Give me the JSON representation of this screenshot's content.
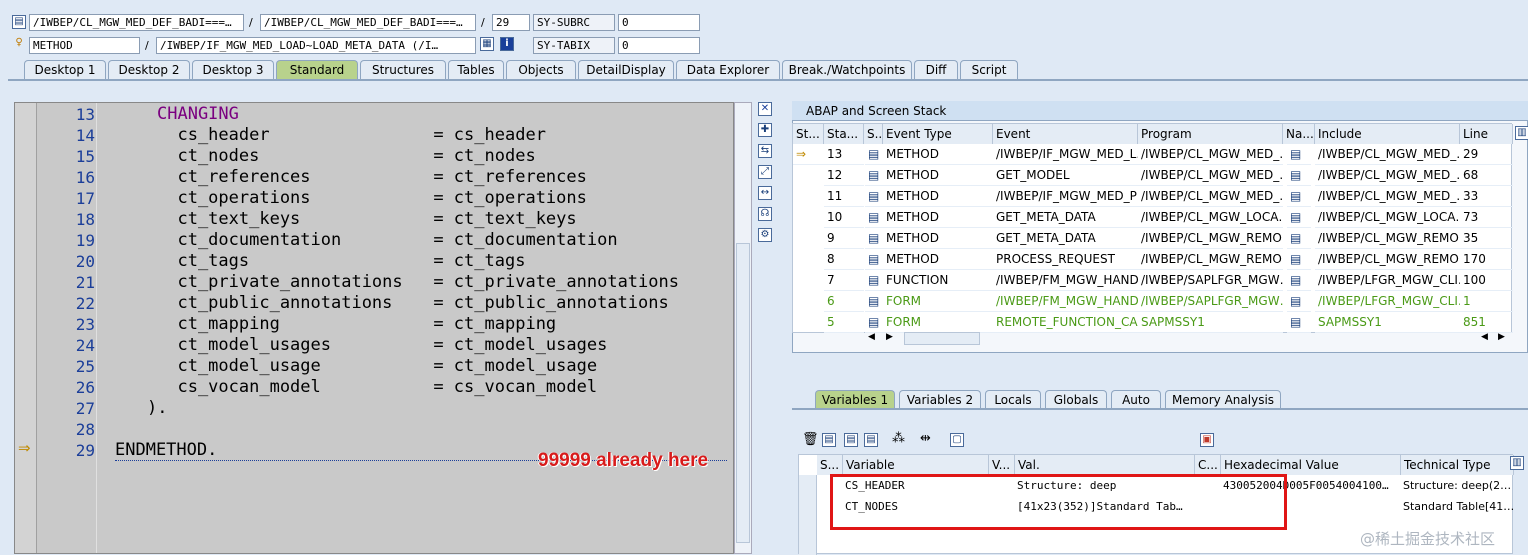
{
  "header": {
    "row1": {
      "field1": "/IWBEP/CL_MGW_MED_DEF_BADI===…",
      "sep": "/",
      "field2": "/IWBEP/CL_MGW_MED_DEF_BADI===…",
      "sep2": "/",
      "line": "29",
      "syslabel": "SY-SUBRC",
      "sysvalue": "0"
    },
    "row2": {
      "field1": "METHOD",
      "sep": "/",
      "field2": "/IWBEP/IF_MGW_MED_LOAD~LOAD_META_DATA (/I…",
      "syslabel": "SY-TABIX",
      "sysvalue": "0"
    }
  },
  "tabs": [
    "Desktop 1",
    "Desktop 2",
    "Desktop 3",
    "Standard",
    "Structures",
    "Tables",
    "Objects",
    "DetailDisplay",
    "Data Explorer",
    "Break./Watchpoints",
    "Diff",
    "Script"
  ],
  "active_tab": "Standard",
  "editor": {
    "lines": [
      {
        "no": "13",
        "kw": "CHANGING",
        "text": ""
      },
      {
        "no": "14",
        "text": "  cs_header                = cs_header"
      },
      {
        "no": "15",
        "text": "  ct_nodes                 = ct_nodes"
      },
      {
        "no": "16",
        "text": "  ct_references            = ct_references"
      },
      {
        "no": "17",
        "text": "  ct_operations            = ct_operations"
      },
      {
        "no": "18",
        "text": "  ct_text_keys             = ct_text_keys"
      },
      {
        "no": "19",
        "text": "  ct_documentation         = ct_documentation"
      },
      {
        "no": "20",
        "text": "  ct_tags                  = ct_tags"
      },
      {
        "no": "21",
        "text": "  ct_private_annotations   = ct_private_annotations"
      },
      {
        "no": "22",
        "text": "  ct_public_annotations    = ct_public_annotations"
      },
      {
        "no": "23",
        "text": "  ct_mapping               = ct_mapping"
      },
      {
        "no": "24",
        "text": "  ct_model_usages          = ct_model_usages"
      },
      {
        "no": "25",
        "text": "  ct_model_usage           = ct_model_usage"
      },
      {
        "no": "26",
        "text": "  cs_vocan_model           = cs_vocan_model"
      },
      {
        "no": "27",
        "text": ")."
      },
      {
        "no": "28",
        "text": ""
      },
      {
        "no": "29",
        "text": "ENDMETHOD."
      }
    ],
    "annotation": "99999 already here"
  },
  "stack": {
    "title": "ABAP and Screen Stack",
    "columns": [
      "St...",
      "Sta...",
      "S...",
      "Event Type",
      "Event",
      "Program",
      "Na...",
      "Include",
      "Line"
    ],
    "rows": [
      {
        "level": "13",
        "type": "METHOD",
        "event": "/IWBEP/IF_MGW_MED_L…",
        "program": "/IWBEP/CL_MGW_MED_…",
        "include": "/IWBEP/CL_MGW_MED_…",
        "line": "29",
        "current": true,
        "green": false
      },
      {
        "level": "12",
        "type": "METHOD",
        "event": "GET_MODEL",
        "program": "/IWBEP/CL_MGW_MED_…",
        "include": "/IWBEP/CL_MGW_MED_…",
        "line": "68",
        "current": false,
        "green": false
      },
      {
        "level": "11",
        "type": "METHOD",
        "event": "/IWBEP/IF_MGW_MED_P…",
        "program": "/IWBEP/CL_MGW_MED_…",
        "include": "/IWBEP/CL_MGW_MED_…",
        "line": "33",
        "current": false,
        "green": false
      },
      {
        "level": "10",
        "type": "METHOD",
        "event": "GET_META_DATA",
        "program": "/IWBEP/CL_MGW_LOCA…",
        "include": "/IWBEP/CL_MGW_LOCA…",
        "line": "73",
        "current": false,
        "green": false
      },
      {
        "level": "9",
        "type": "METHOD",
        "event": "GET_META_DATA",
        "program": "/IWBEP/CL_MGW_REMO…",
        "include": "/IWBEP/CL_MGW_REMO…",
        "line": "35",
        "current": false,
        "green": false
      },
      {
        "level": "8",
        "type": "METHOD",
        "event": "PROCESS_REQUEST",
        "program": "/IWBEP/CL_MGW_REMO…",
        "include": "/IWBEP/CL_MGW_REMO…",
        "line": "170",
        "current": false,
        "green": false
      },
      {
        "level": "7",
        "type": "FUNCTION",
        "event": "/IWBEP/FM_MGW_HAND…",
        "program": "/IWBEP/SAPLFGR_MGW…",
        "include": "/IWBEP/LFGR_MGW_CLI…",
        "line": "100",
        "current": false,
        "green": false
      },
      {
        "level": "6",
        "type": "FORM",
        "event": "/IWBEP/FM_MGW_HAND…",
        "program": "/IWBEP/SAPLFGR_MGW…",
        "include": "/IWBEP/LFGR_MGW_CLI…",
        "line": "1",
        "current": false,
        "green": true
      },
      {
        "level": "5",
        "type": "FORM",
        "event": "REMOTE_FUNCTION_CA…",
        "program": "SAPMSSY1",
        "include": "SAPMSSY1",
        "line": "851",
        "current": false,
        "green": true
      }
    ]
  },
  "var_tabs": [
    "Variables 1",
    "Variables 2",
    "Locals",
    "Globals",
    "Auto",
    "Memory Analysis"
  ],
  "var_active": "Variables 1",
  "variables": {
    "columns": [
      "S...",
      "Variable",
      "V...",
      "Val.",
      "C...",
      "Hexadecimal Value",
      "Technical Type"
    ],
    "rows": [
      {
        "name": "CS_HEADER",
        "value": "Structure: deep",
        "hex": "430052004D005F0054004100…",
        "type": "Structure: deep(2…"
      },
      {
        "name": "CT_NODES",
        "value": "[41x23(352)]Standard Tab…",
        "hex": "",
        "type": "Standard Table[41…"
      }
    ]
  },
  "watermark": "@稀土掘金技术社区"
}
